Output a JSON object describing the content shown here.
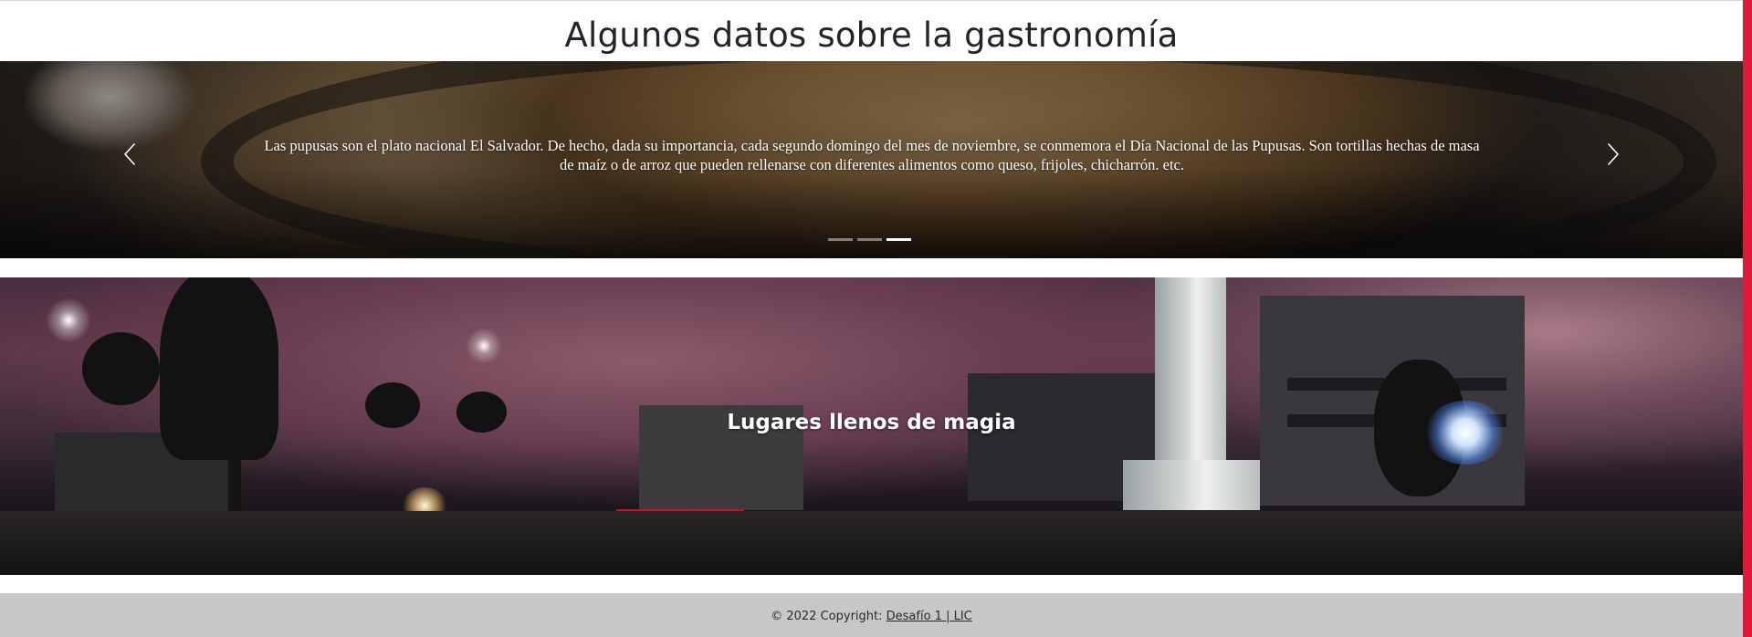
{
  "gastronomy": {
    "title": "Algunos datos sobre la gastronomía",
    "carousel": {
      "caption": "Las pupusas son el plato nacional El Salvador. De hecho, dada su importancia, cada segundo domingo del mes de noviembre, se conmemora el Día Nacional de las Pupusas. Son tortillas hechas de masa de maíz o de arroz que pueden rellenarse con diferentes alimentos como queso, frijoles, chicharrón. etc.",
      "prev_icon": "chevron-left-icon",
      "next_icon": "chevron-right-icon",
      "slide_count": 3,
      "active_slide": 3
    }
  },
  "places": {
    "title": "Lugares llenos de magia"
  },
  "footer": {
    "copyright_prefix": "© 2022 Copyright: ",
    "link_label": "Desafío 1 | LIC"
  },
  "colors": {
    "accent": "#e0193a",
    "footer_bg": "#c6c7c9",
    "heading_text": "#212529"
  }
}
